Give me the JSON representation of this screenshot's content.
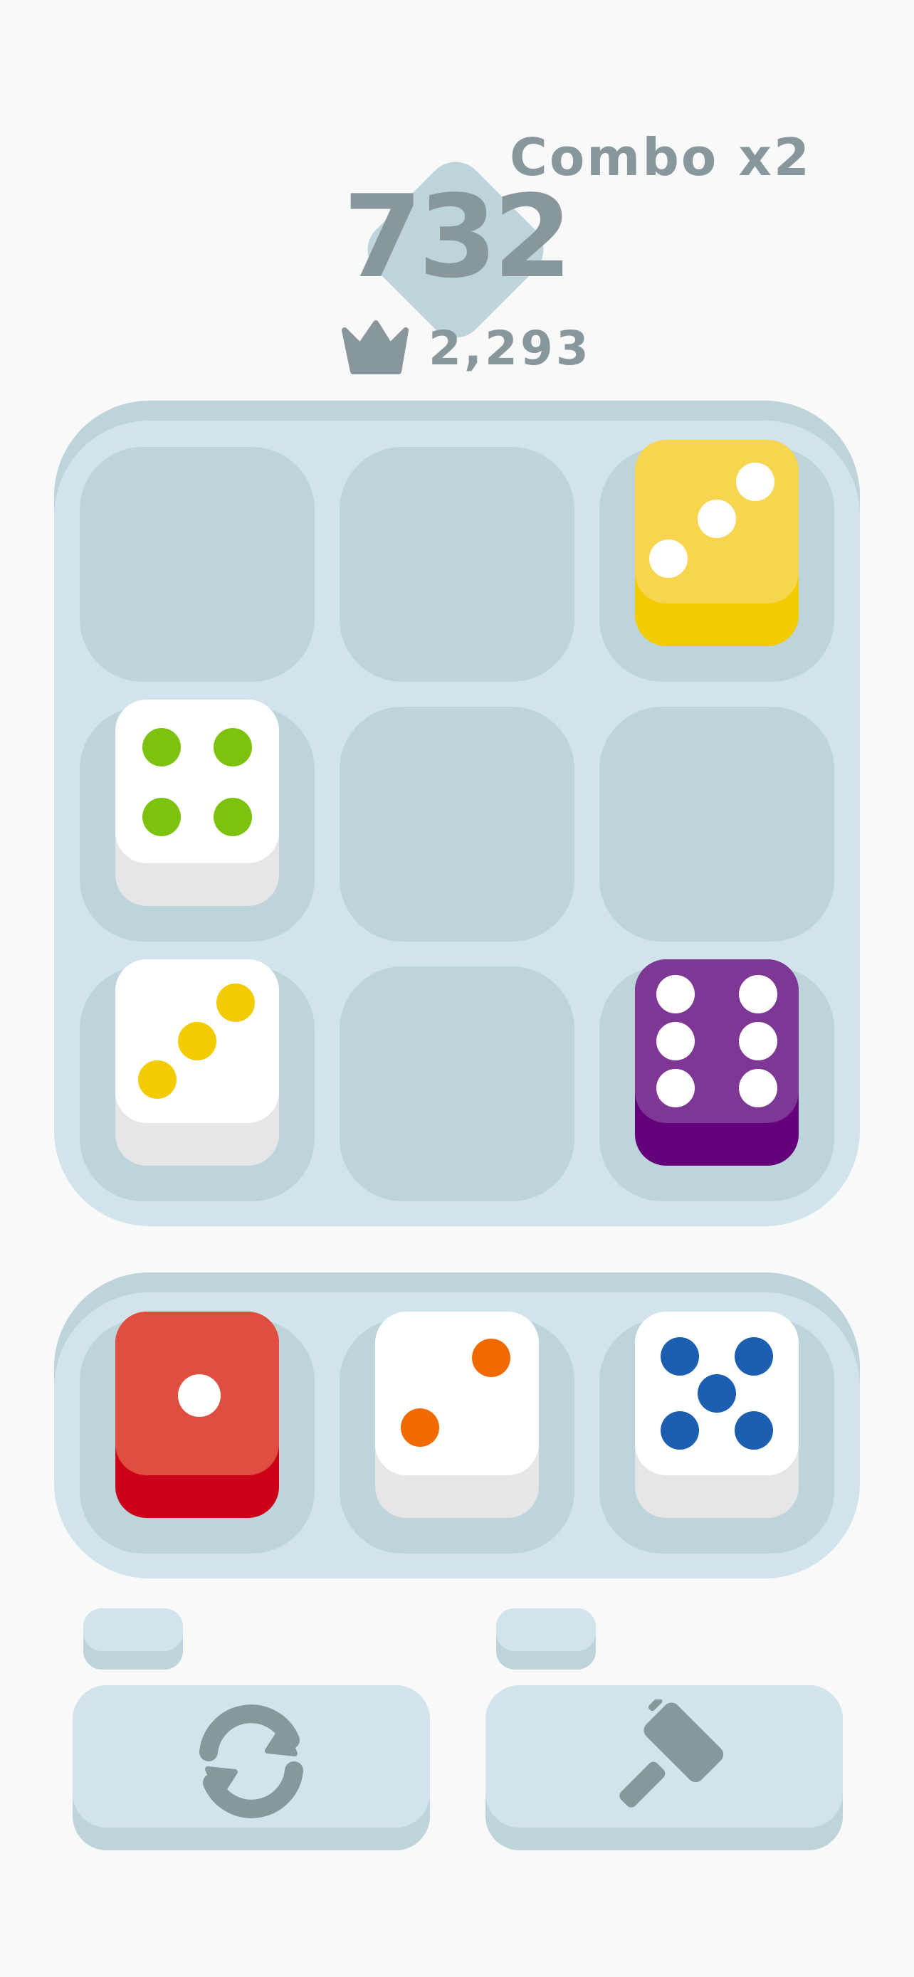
{
  "header": {
    "combo_text": "Combo x2",
    "score": "732",
    "best_score": "2,293",
    "best_icon": "crown-icon"
  },
  "board": {
    "rows": 3,
    "cols": 3,
    "cells": [
      null,
      null,
      {
        "value": 3,
        "color": "yellow"
      },
      {
        "value": 4,
        "color": "green"
      },
      null,
      null,
      {
        "value": 3,
        "color": "yellow"
      },
      null,
      {
        "value": 6,
        "color": "purple"
      }
    ]
  },
  "rack": {
    "dice": [
      {
        "value": 1,
        "color": "red"
      },
      {
        "value": 2,
        "color": "orange"
      },
      {
        "value": 5,
        "color": "blue"
      }
    ]
  },
  "powerups": [
    {
      "name": "reroll",
      "icon": "refresh-icon",
      "count": ""
    },
    {
      "name": "hammer",
      "icon": "hammer-icon",
      "count": ""
    }
  ],
  "colors": {
    "background": "#f9f9f9",
    "tray": "#d2e4eb",
    "slot": "#bcd4da",
    "text": "#87979c",
    "yellow_die": "#f7d54e",
    "purple_die": "#7e3794",
    "red_die": "#e04e3f",
    "green_pip": "#7dc20f",
    "yellow_pip": "#f2cb00",
    "orange_pip": "#f06a00",
    "blue_pip": "#1c5fb0"
  }
}
